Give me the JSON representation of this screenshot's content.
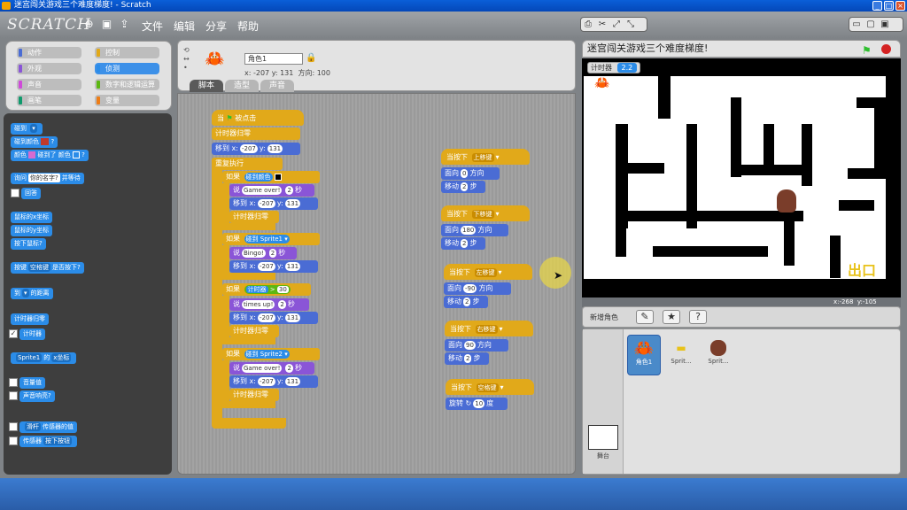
{
  "window": {
    "title": "迷宫闯关游戏三个难度梯度! - Scratch"
  },
  "menubar": {
    "logo": "SCRATCH",
    "file": "文件",
    "edit": "编辑",
    "share": "分享",
    "help": "帮助"
  },
  "categories": [
    {
      "label": "动作",
      "color": "#4a6cd4"
    },
    {
      "label": "控制",
      "color": "#e1a91a"
    },
    {
      "label": "外观",
      "color": "#8a55d7"
    },
    {
      "label": "侦测",
      "color": "#2b8ce8"
    },
    {
      "label": "声音",
      "color": "#cf4ad9"
    },
    {
      "label": "数字和逻辑运算",
      "color": "#5cb712"
    },
    {
      "label": "画笔",
      "color": "#0e9a6c"
    },
    {
      "label": "变量",
      "color": "#ee7d16"
    }
  ],
  "palette": {
    "touching": "碰到",
    "touching_color": "碰到颜色",
    "color_a": "颜色",
    "color_touching": "碰到了",
    "color_b": "颜色",
    "q": "?",
    "ask": "询问",
    "ask_default": "你的名字?",
    "ask_wait": "并等待",
    "answer": "回答",
    "mouse_x": "鼠标的x坐标",
    "mouse_y": "鼠标的y坐标",
    "mouse_down": "按下鼠标?",
    "key": "按键",
    "key_name": "空格键",
    "key_pressed": "是否按下?",
    "distance_to": "到",
    "distance_label": "的距离",
    "timer_reset": "计时器归零",
    "timer": "计时器",
    "sprite_attr_sprite": "Sprite1",
    "sprite_attr_of": "的",
    "sprite_attr_prop": "x坐标",
    "loudness": "音量值",
    "loud": "声音响亮?",
    "slider": "滑杆",
    "sensor_value": "传感器的值",
    "sensor": "传感器",
    "sensor_pressed": "按下按钮"
  },
  "sprite": {
    "name": "角色1",
    "x_label": "x:",
    "x": "-207",
    "y_label": "y:",
    "y": "131",
    "dir_label": "方向:",
    "direction": "100"
  },
  "tabs": [
    "脚本",
    "造型",
    "声音"
  ],
  "script_main": {
    "hat_when": "当",
    "hat_clicked": "被点击",
    "timer_reset": "计时器归零",
    "goto": "移到 x:",
    "y": "y:",
    "gx": "-207",
    "gy": "131",
    "forever": "重复执行",
    "if": "如果",
    "touch_color": "碰到颜色",
    "say": "说",
    "gameover": "Game over!",
    "secs": "2",
    "sec_label": "秒",
    "touch": "碰到",
    "sprite1": "Sprite1",
    "bingo": "Bingo!",
    "timer": "计时器",
    "gt": ">",
    "limit": "30",
    "timesup": "times up!",
    "sprite2": "Sprite2"
  },
  "key_scripts": [
    {
      "when": "当按下",
      "key": "上移键",
      "face": "面向",
      "dir": "0",
      "dir_label": "方向",
      "move": "移动",
      "steps": "2",
      "steps_label": "步"
    },
    {
      "when": "当按下",
      "key": "下移键",
      "face": "面向",
      "dir": "180",
      "dir_label": "方向",
      "move": "移动",
      "steps": "2",
      "steps_label": "步"
    },
    {
      "when": "当按下",
      "key": "左移键",
      "face": "面向",
      "dir": "-90",
      "dir_label": "方向",
      "move": "移动",
      "steps": "2",
      "steps_label": "步"
    },
    {
      "when": "当按下",
      "key": "右移键",
      "face": "面向",
      "dir": "90",
      "dir_label": "方向",
      "move": "移动",
      "steps": "2",
      "steps_label": "步"
    }
  ],
  "key_space": {
    "when": "当按下",
    "key": "空格键",
    "turn": "旋转",
    "deg": "10",
    "deg_label": "度"
  },
  "stage": {
    "title": "迷宫闯关游戏三个难度梯度!",
    "timer_label": "计时器",
    "timer_value": "2.2",
    "mouse_x_label": "x:",
    "mouse_x": "-268",
    "mouse_y_label": "y:",
    "mouse_y": "-105",
    "exit_text": "出口"
  },
  "newsprite": {
    "label": "新增角色"
  },
  "sprites": [
    {
      "name": "角色1",
      "selected": true
    },
    {
      "name": "Sprit...",
      "selected": false
    },
    {
      "name": "Sprit...",
      "selected": false
    }
  ],
  "stage_thumb": {
    "label": "舞台"
  },
  "colors": {
    "accent": "#3c90e8",
    "motion": "#4a6cd4",
    "looks": "#8a55d7",
    "control": "#e1a91a",
    "sensing": "#2b8ce8",
    "operators": "#5cb712",
    "variables": "#ee7d16"
  }
}
